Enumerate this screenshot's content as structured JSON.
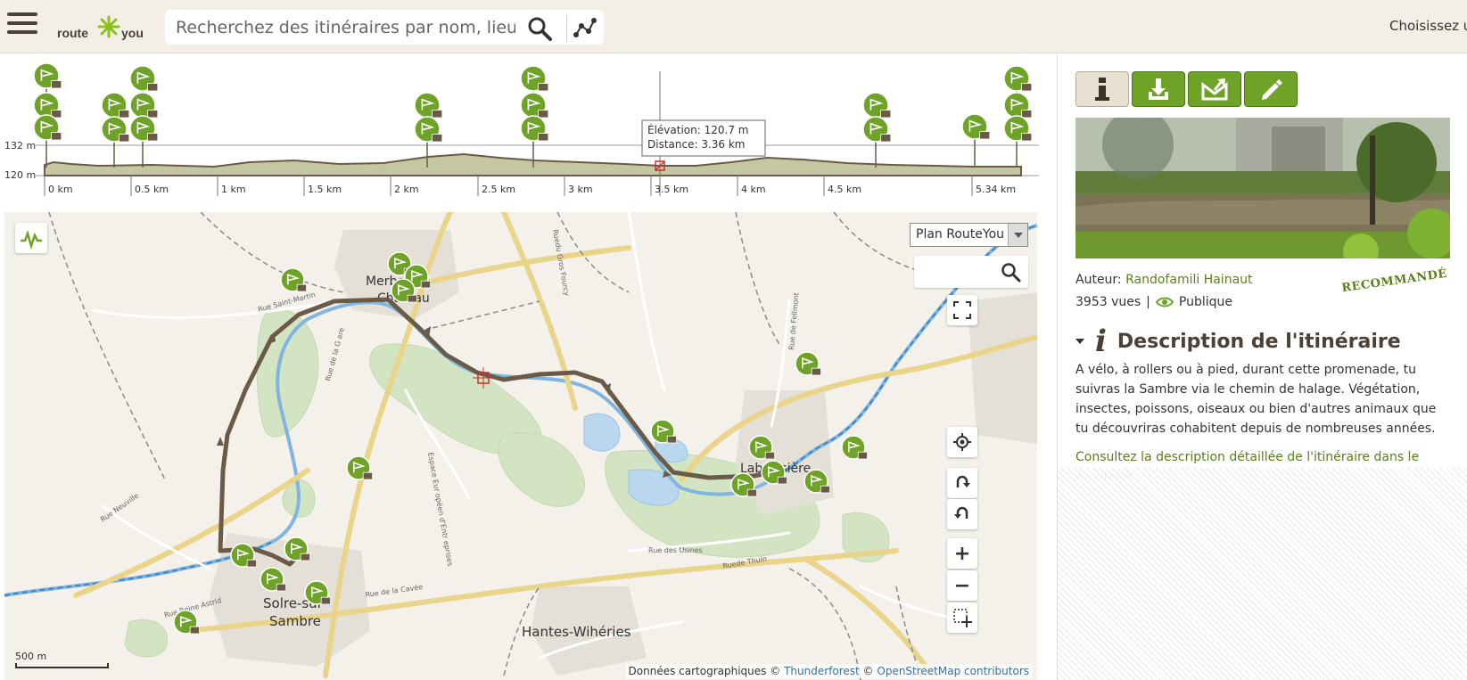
{
  "header": {
    "logo_route": "route",
    "logo_you": "you",
    "search_placeholder": "Recherchez des itinéraires par nom, lieu, au",
    "choose_label": "Choisissez u"
  },
  "elevation": {
    "y_labels": [
      "132 m",
      "120 m"
    ],
    "x_labels": [
      "0 km",
      "0.5 km",
      "1 km",
      "1.5 km",
      "2 km",
      "2.5 km",
      "3 km",
      "3.5 km",
      "4 km",
      "4.5 km",
      "5.34 km"
    ],
    "tooltip_elevation": "Élévation: 120.7 m",
    "tooltip_distance": "Distance: 3.36 km"
  },
  "map": {
    "map_type": "Plan RouteYou",
    "scale_label": "500 m",
    "attribution_prefix": "Données cartographiques ©",
    "attribution_tf": "Thunderforest",
    "attribution_sep": "©",
    "attribution_osm": "OpenStreetMap contributors",
    "towns": {
      "merbes": "Merbes-",
      "chateau": "Château",
      "labuissiere": "Labuissière",
      "solre1": "Solre-sur-",
      "solre2": "Sambre",
      "hantes": "Hantes-Wihéries"
    },
    "streets": {
      "s1": "Rue Saint-Martin",
      "s2": "Rue de la G are",
      "s3": "Rue Neuville",
      "s4": "Rue Reine Astrid",
      "s5": "Rue de la Cavée",
      "s6": "Rue des Usines",
      "s7": "Ruede Thuin",
      "s8": "Espace Eur opéen d'Entr eprises",
      "s9": "Ruedu Gros Fourcy",
      "s10": "Rue de Fellmont"
    }
  },
  "sidebar": {
    "author_label": "Auteur:",
    "author_name": "Randofamili Hainaut",
    "views": "3953 vues",
    "separator": "|",
    "visibility": "Publique",
    "recommended": "RECOMMANDÉ",
    "desc_title": "Description de l'itinéraire",
    "desc_text": "A vélo, à rollers ou à pied, durant cette promenade, tu suivras la Sambre via le chemin de halage. Végétation, insectes, poissons, oiseaux ou bien d'autres animaux que tu découvriras cohabitent depuis de nombreuses années.",
    "desc_link": "Consultez la description détaillée de l'itinéraire dans le roadbook"
  },
  "colors": {
    "route": "#6b5a47",
    "poi_green": "#6ea327",
    "accent_link": "#5e7d1c"
  }
}
